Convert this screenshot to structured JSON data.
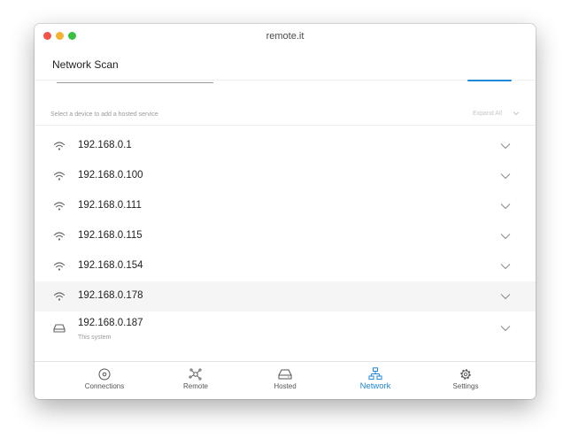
{
  "window": {
    "title": "remote.it"
  },
  "page": {
    "title": "Network Scan",
    "hint": "Select a device to add a hosted service",
    "expand_all": "Expand All"
  },
  "devices": [
    {
      "label": "192.168.0.1",
      "sub": "",
      "icon": "wifi-icon"
    },
    {
      "label": "192.168.0.100",
      "sub": "",
      "icon": "wifi-icon"
    },
    {
      "label": "192.168.0.111",
      "sub": "",
      "icon": "wifi-icon"
    },
    {
      "label": "192.168.0.115",
      "sub": "",
      "icon": "wifi-icon"
    },
    {
      "label": "192.168.0.154",
      "sub": "",
      "icon": "wifi-icon"
    },
    {
      "label": "192.168.0.178",
      "sub": "",
      "icon": "wifi-icon"
    },
    {
      "label": "192.168.0.187",
      "sub": "This system",
      "icon": "hard-drive-icon"
    }
  ],
  "tabs": [
    {
      "label": "Connections",
      "icon": "connections-icon"
    },
    {
      "label": "Remote",
      "icon": "remote-icon"
    },
    {
      "label": "Hosted",
      "icon": "hard-drive-icon"
    },
    {
      "label": "Network",
      "icon": "network-icon"
    },
    {
      "label": "Settings",
      "icon": "gear-icon"
    }
  ],
  "colors": {
    "accent": "#1f87d6",
    "traffic_red": "#f2544c",
    "traffic_yellow": "#f3b331",
    "traffic_green": "#3ac040"
  }
}
